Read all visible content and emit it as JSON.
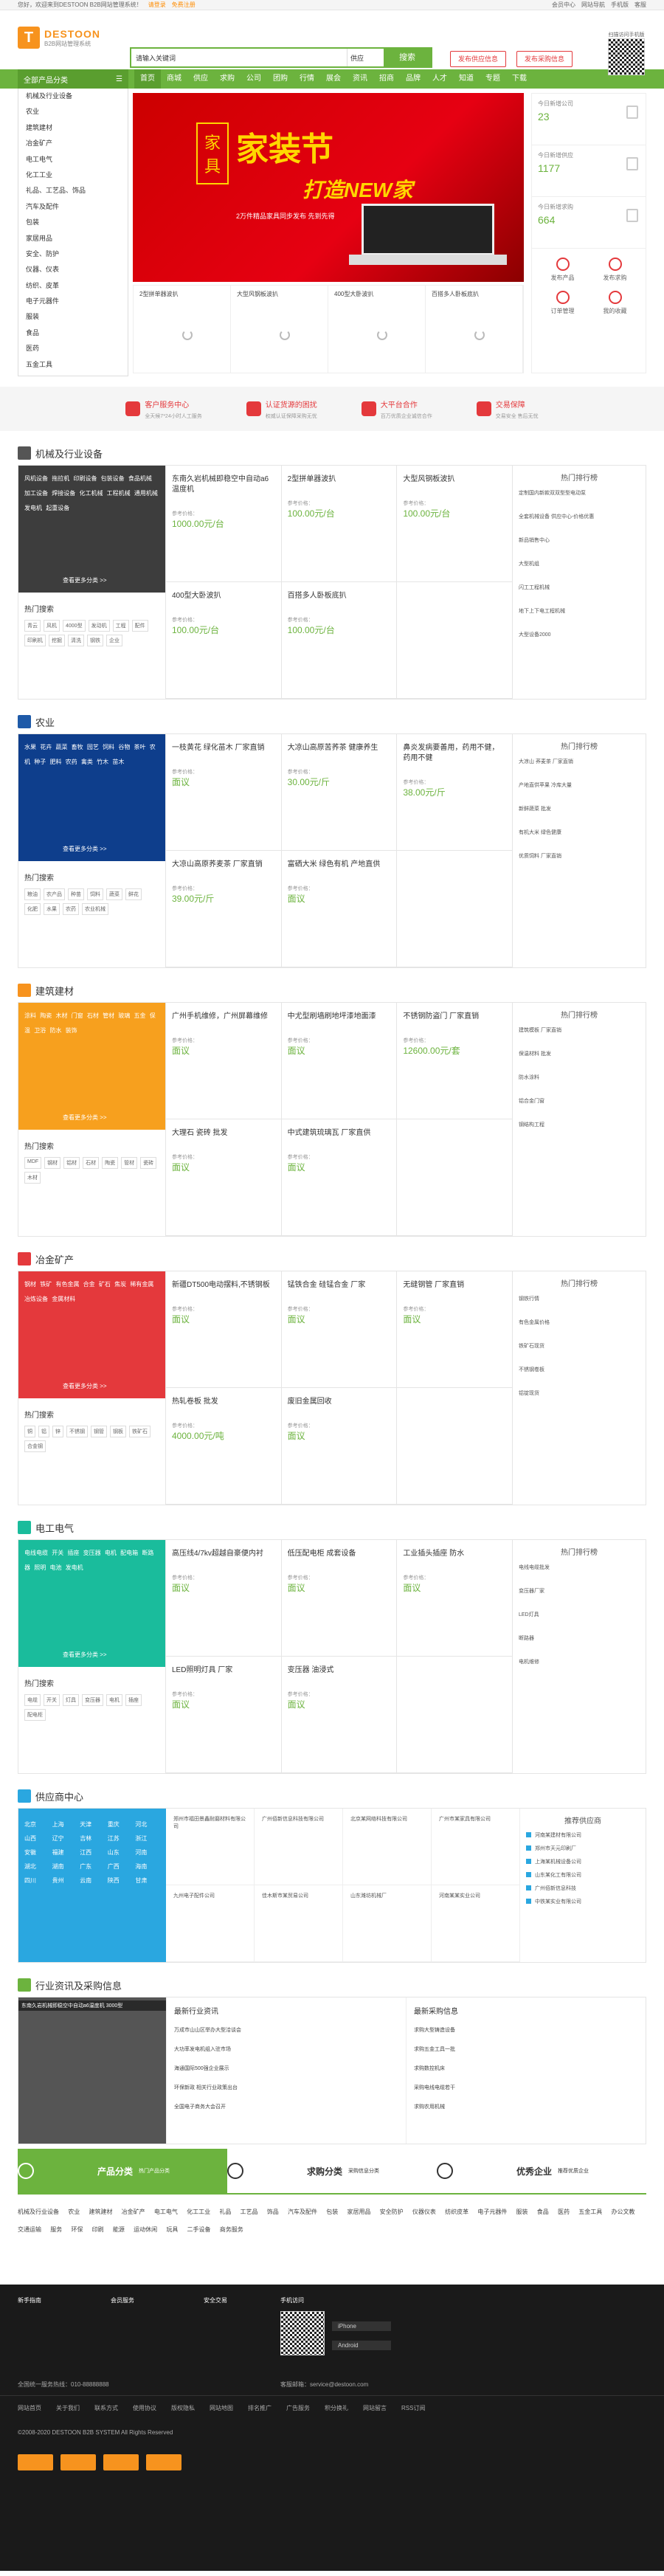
{
  "topbar": {
    "welcome": "您好，欢迎来到DESTOON B2B网站管理系统！",
    "login": "请登录",
    "register": "免费注册",
    "links": [
      "会员中心",
      "网站导航",
      "手机版",
      "客服"
    ]
  },
  "logo": {
    "mark": "T",
    "name": "DESTOON",
    "slogan": "B2B网站管理系统"
  },
  "search": {
    "value": "请输入关键词",
    "scope": "供应",
    "button": "搜索"
  },
  "header_buttons": {
    "sell": "发布供应信息",
    "buy": "发布采购信息"
  },
  "qr_label": "扫描访问手机版",
  "nav": {
    "all": "全部产品分类",
    "items": [
      "首页",
      "商城",
      "供应",
      "求购",
      "公司",
      "团购",
      "行情",
      "展会",
      "资讯",
      "招商",
      "品牌",
      "人才",
      "知道",
      "专题",
      "下载"
    ]
  },
  "categories": [
    "机械及行业设备",
    "农业",
    "建筑建材",
    "冶金矿产",
    "电工电气",
    "化工工业",
    "礼品、工艺品、饰品",
    "汽车及配件",
    "包装",
    "家居用品",
    "安全、防护",
    "仪器、仪表",
    "纺织、皮革",
    "电子元器件",
    "服装",
    "食品",
    "医药",
    "五金工具"
  ],
  "banner": {
    "badge1": "家",
    "badge2": "具",
    "title": "家装节",
    "subtitle": "打造NEW家",
    "desc": "2万件精品家具同步发布 先到先得"
  },
  "banner_thumbs": [
    "2型拼单器波扒",
    "大型风钢板波扒",
    "400型大卧波扒",
    "百搭多人卧板底扒"
  ],
  "stats": [
    {
      "label": "今日新增公司",
      "value": "23"
    },
    {
      "label": "今日新增供应",
      "value": "1177"
    },
    {
      "label": "今日新增求购",
      "value": "664"
    }
  ],
  "actions": [
    "发布产品",
    "发布求购",
    "订单管理",
    "我的收藏"
  ],
  "services": [
    {
      "title": "客户服务中心",
      "desc": "全天候7*24小时人工服务"
    },
    {
      "title": "认证货源的困扰",
      "desc": "权威认证保障采购无忧"
    },
    {
      "title": "大平台合作",
      "desc": "百万优质企业诚信合作"
    },
    {
      "title": "交易保障",
      "desc": "交易安全 售后无忧"
    }
  ],
  "sections": [
    {
      "title": "机械及行业设备",
      "color": "#3d3d3d",
      "icon": "#555",
      "links": "风机设备 拖拉机 印刷设备 包装设备 食品机械 加工设备 焊接设备 化工机械 工程机械 通用机械 发电机 起重设备",
      "tags": [
        "青云",
        "风机",
        "4000型",
        "发动机",
        "工程",
        "配件",
        "印刷机",
        "挖掘",
        "清洗",
        "钢铁",
        "企业"
      ],
      "cells": [
        {
          "name": "东南久岩机械即稳空中自动a6温度机",
          "price": "1000.00元/台"
        },
        {
          "name": "2型拼单器波扒",
          "price": "100.00元/台"
        },
        {
          "name": "大型风钢板波扒",
          "price": "100.00元/台"
        },
        {
          "name": "400型大卧波扒",
          "price": "100.00元/台"
        },
        {
          "name": "百搭多人卧板底扒",
          "price": "100.00元/台"
        }
      ],
      "hot": [
        "定制国内新款双双型型电动泵",
        "全套机械设备 供应中心-价格优惠",
        "新品销售中心",
        "大型机组",
        "闪工工程机械",
        "地下上下电工程机械",
        "大型设备2000"
      ]
    },
    {
      "title": "农业",
      "color": "#0e3e8c",
      "icon": "#1e5aa8",
      "links": "水果 花卉 蔬菜 畜牧 园艺 饲料 谷物 茶叶 农机 种子 肥料 农药 禽类 竹木 苗木",
      "tags": [
        "粮油",
        "农产品",
        "种苗",
        "饲料",
        "蔬菜",
        "鲜花",
        "化肥",
        "水果",
        "农药",
        "农业机械"
      ],
      "cells": [
        {
          "name": "一枝黄花 绿化苗木 厂家直销",
          "price": "面议"
        },
        {
          "name": "大凉山高原苦荞茶 健康养生",
          "price": "30.00元/斤"
        },
        {
          "name": "鼻炎发病要善用，药用不健，药用不健",
          "price": "38.00元/斤"
        },
        {
          "name": "大凉山高原荞麦茶 厂家直销",
          "price": "39.00元/斤"
        },
        {
          "name": "富硒大米 绿色有机 产地直供",
          "price": "面议"
        }
      ],
      "hot": [
        "大凉山 荞麦茶 厂家直销",
        "产地直供苹果 冷库大量",
        "新鲜蔬菜 批发",
        "有机大米 绿色健康",
        "优质饲料 厂家直销"
      ]
    },
    {
      "title": "建筑建材",
      "color": "#f7a01e",
      "icon": "#f7931e",
      "links": "涂料 陶瓷 木材 门窗 石材 管材 玻璃 五金 保温 卫浴 防水 装饰",
      "tags": [
        "MDF",
        "钢材",
        "铝材",
        "石材",
        "陶瓷",
        "管材",
        "瓷砖",
        "木材"
      ],
      "cells": [
        {
          "name": "广州手机维修，广州屏幕维修",
          "price": "面议"
        },
        {
          "name": "中尤型刷墙刷地坪漆地面漆",
          "price": "面议"
        },
        {
          "name": "不锈钢防盗门 厂家直销",
          "price": "12600.00元/套"
        },
        {
          "name": "大理石 瓷砖 批发",
          "price": "面议"
        },
        {
          "name": "中式建筑琉璃瓦 厂家直供",
          "price": "面议"
        }
      ],
      "hot": [
        "建筑模板 厂家直销",
        "保温材料 批发",
        "防水涂料",
        "铝合金门窗",
        "钢结构工程"
      ]
    },
    {
      "title": "冶金矿产",
      "color": "#e4393c",
      "icon": "#e4393c",
      "links": "钢材 铁矿 有色金属 合金 矿石 焦炭 稀有金属 冶炼设备 金属材料",
      "tags": [
        "铜",
        "铝",
        "锌",
        "不锈钢",
        "钢管",
        "钢板",
        "铁矿石",
        "合金钢"
      ],
      "cells": [
        {
          "name": "新疆DT500电动摆料,不锈钢板",
          "price": "面议"
        },
        {
          "name": "锰铁合金 硅锰合金 厂家",
          "price": "面议"
        },
        {
          "name": "无缝钢管 厂家直销",
          "price": "面议"
        },
        {
          "name": "热轧卷板 批发",
          "price": "4000.00元/吨"
        },
        {
          "name": "废旧金属回收",
          "price": "面议"
        }
      ],
      "hot": [
        "钢铁行情",
        "有色金属价格",
        "铁矿石现货",
        "不锈钢卷板",
        "铝锭现货"
      ]
    },
    {
      "title": "电工电气",
      "color": "#1abc9c",
      "icon": "#1abc9c",
      "links": "电线电缆 开关 插座 变压器 电机 配电箱 断路器 照明 电池 发电机",
      "tags": [
        "电缆",
        "开关",
        "灯具",
        "变压器",
        "电机",
        "插座",
        "配电柜"
      ],
      "cells": [
        {
          "name": "高压线4/7kv超越自豪便内衬",
          "price": "面议"
        },
        {
          "name": "低压配电柜 成套设备",
          "price": "面议"
        },
        {
          "name": "工业插头插座 防水",
          "price": "面议"
        },
        {
          "name": "LED照明灯具 厂家",
          "price": "面议"
        },
        {
          "name": "变压器 油浸式",
          "price": "面议"
        }
      ],
      "hot": [
        "电线电缆批发",
        "变压器厂家",
        "LED灯具",
        "断路器",
        "电机维修"
      ]
    }
  ],
  "supplier": {
    "title": "供应商中心",
    "cities": [
      "北京",
      "上海",
      "天津",
      "重庆",
      "河北",
      "山西",
      "辽宁",
      "吉林",
      "江苏",
      "浙江",
      "安徽",
      "福建",
      "江西",
      "山东",
      "河南",
      "湖北",
      "湖南",
      "广东",
      "广西",
      "海南",
      "四川",
      "贵州",
      "云南",
      "陕西",
      "甘肃"
    ],
    "companies": [
      "郑州市福田景鑫耐磨材料有限公司",
      "广州佰新信息科技有限公司",
      "北京某网络科技有限公司",
      "广州市某家具有限公司",
      "九州电子配件公司",
      "佳木斯市某贸易公司",
      "山东潍坊机械厂",
      "河南某某实业公司"
    ],
    "right_title": "推荐供应商",
    "rec": [
      "河南某建材有限公司",
      "郑州市天元印刷厂",
      "上海某机械设备公司",
      "山东某化工有限公司",
      "广州佰新信息科技",
      "中铁某实业有限公司"
    ]
  },
  "news": {
    "title": "行业资讯及采购信息",
    "caption": "东南久岩机械即稳空中自动a6温度机 3000型",
    "col1": "最新行业资讯",
    "col1_items": [
      "万成市山山区举办大型洽谈会",
      "大功率发电机组入驻市场",
      "海通国际500强企业展示",
      "环保新政 相关行业政策出台",
      "全国电子商务大会召开"
    ],
    "col2": "最新采购信息",
    "col2_items": [
      "求购大型铸造设备",
      "求购五金工具一批",
      "求购数控机床",
      "采购电线电缆若干",
      "求购农用机械"
    ]
  },
  "tabs3": [
    {
      "title": "产品分类",
      "desc": "热门产品分类"
    },
    {
      "title": "求购分类",
      "desc": "采购信息分类"
    },
    {
      "title": "优秀企业",
      "desc": "推荐优质企业"
    }
  ],
  "catlinks": "机械及行业设备 农业 建筑建材 冶金矿产 电工电气 化工工业 礼品 工艺品 饰品 汽车及配件 包装 家居用品 安全防护 仪器仪表 纺织皮革 电子元器件 服装 食品 医药 五金工具 办公文教 交通运输 服务 环保 印刷 能源 运动休闲 玩具 二手设备 商务服务",
  "footer": {
    "cols": [
      "新手指南",
      "会员服务",
      "安全交易",
      "手机访问"
    ],
    "hotline": "全国统一服务热线：010-88888888",
    "email": "客服邮箱：service@destoon.com",
    "links": [
      "网站首页",
      "关于我们",
      "联系方式",
      "使用协议",
      "版权隐私",
      "网站地图",
      "排名推广",
      "广告服务",
      "积分换礼",
      "网站留言",
      "RSS订阅"
    ],
    "copyright": "©2008-2020 DESTOON B2B SYSTEM All Rights Reserved",
    "app": [
      "iPhone",
      "Android"
    ]
  }
}
